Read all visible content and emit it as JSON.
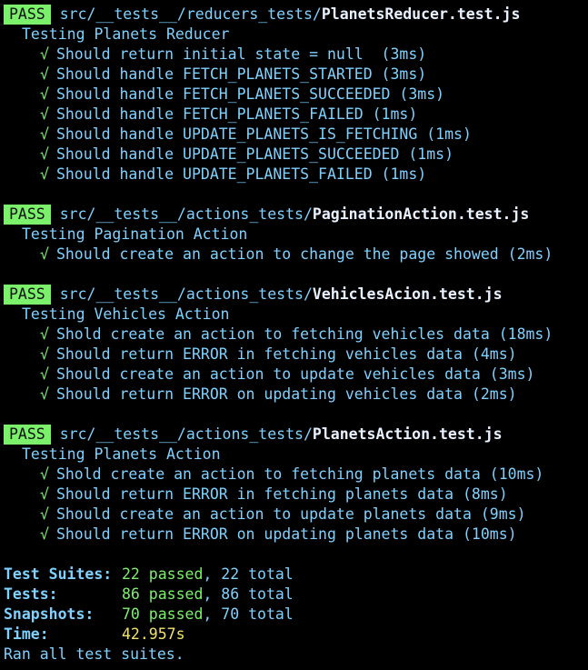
{
  "terminal": {
    "check_glyph": "√",
    "suites": [
      {
        "status": "PASS",
        "path_prefix": "src/__tests__/reducers_tests/",
        "file_name": "PlanetsReducer.test.js",
        "describe": "Testing Planets Reducer",
        "tests": [
          "Should return initial state = null  (3ms)",
          "Should handle FETCH_PLANETS_STARTED (3ms)",
          "Should handle FETCH_PLANETS_SUCCEEDED (3ms)",
          "Should handle FETCH_PLANETS_FAILED (1ms)",
          "Should handle UPDATE_PLANETS_IS_FETCHING (1ms)",
          "Should handle UPDATE_PLANETS_SUCCEEDED (1ms)",
          "Should handle UPDATE_PLANETS_FAILED (1ms)"
        ]
      },
      {
        "status": "PASS",
        "path_prefix": "src/__tests__/actions_tests/",
        "file_name": "PaginationAction.test.js",
        "describe": "Testing Pagination Action",
        "tests": [
          "Should create an action to change the page showed (2ms)"
        ]
      },
      {
        "status": "PASS",
        "path_prefix": "src/__tests__/actions_tests/",
        "file_name": "VehiclesAcion.test.js",
        "describe": "Testing Vehicles Action",
        "tests": [
          "Shold create an action to fetching vehicles data (18ms)",
          "Should return ERROR in fetching vehicles data (4ms)",
          "Should create an action to update vehicles data (3ms)",
          "Should return ERROR on updating vehicles data (2ms)"
        ]
      },
      {
        "status": "PASS",
        "path_prefix": "src/__tests__/actions_tests/",
        "file_name": "PlanetsAction.test.js",
        "describe": "Testing Planets Action",
        "tests": [
          "Shold create an action to fetching planets data (10ms)",
          "Should return ERROR in fetching planets data (8ms)",
          "Should create an action to update planets data (9ms)",
          "Should return ERROR on updating planets data (10ms)"
        ]
      }
    ],
    "summary": {
      "suites_label": "Test Suites:",
      "suites_passed": "22 passed",
      "suites_total": ", 22 total",
      "tests_label": "Tests:",
      "tests_passed": "86 passed",
      "tests_total": ", 86 total",
      "snapshots_label": "Snapshots:",
      "snapshots_passed": "70 passed",
      "snapshots_total": ", 70 total",
      "time_label": "Time:",
      "time_value": "42.957s",
      "footer": "Ran all test suites."
    }
  }
}
